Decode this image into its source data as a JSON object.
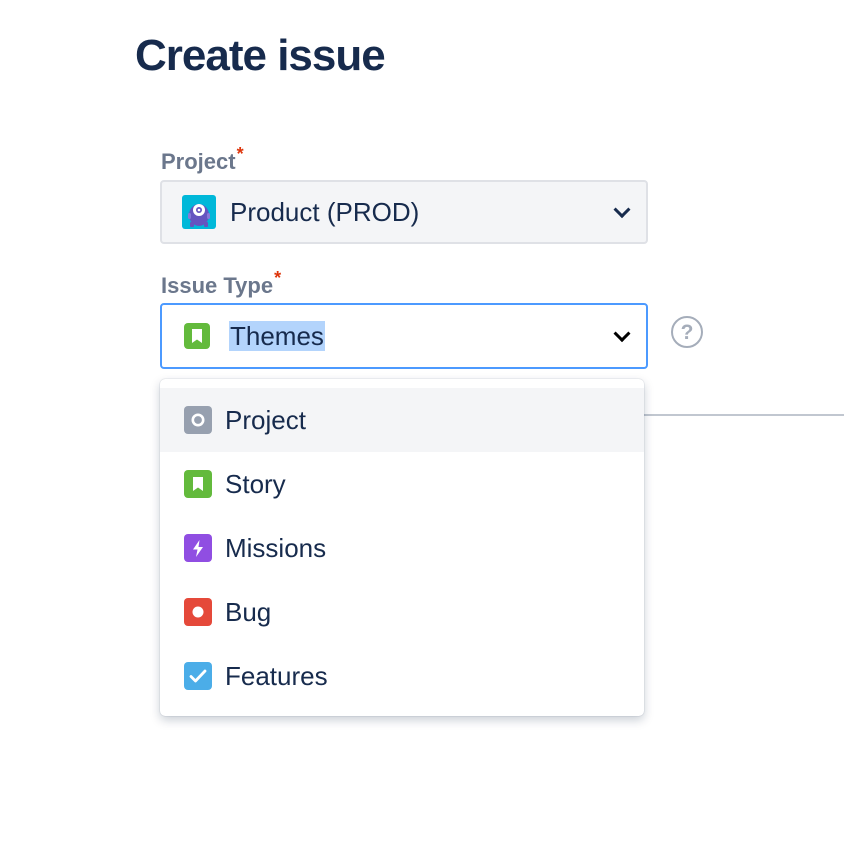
{
  "page": {
    "title": "Create issue"
  },
  "form": {
    "project": {
      "label": "Project",
      "required_mark": "*",
      "value": "Product (PROD)",
      "avatar": "product-avatar-icon"
    },
    "issue_type": {
      "label": "Issue Type",
      "required_mark": "*",
      "value": "Themes",
      "value_icon": "story-bookmark-icon",
      "help": "?"
    }
  },
  "dropdown": {
    "options": [
      {
        "label": "Project",
        "icon": "project-icon",
        "color": "#97A0AF",
        "hovered": true
      },
      {
        "label": "Story",
        "icon": "story-bookmark-icon",
        "color": "#63BA3C"
      },
      {
        "label": "Missions",
        "icon": "lightning-icon",
        "color": "#904EE2"
      },
      {
        "label": "Bug",
        "icon": "bug-dot-icon",
        "color": "#E5493A"
      },
      {
        "label": "Features",
        "icon": "checkmark-icon",
        "color": "#4BADE8"
      }
    ]
  },
  "colors": {
    "focus_border": "#4C9AFF",
    "required": "#DE350B",
    "label": "#6B778C",
    "text": "#172B4D",
    "selection": "#B3D4FC"
  }
}
